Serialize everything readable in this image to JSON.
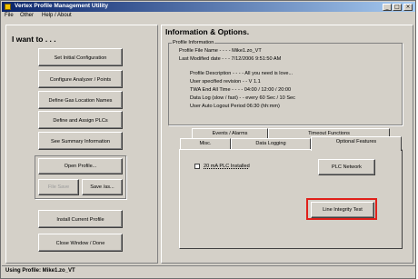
{
  "window": {
    "title": "Vertex Profile Management Utility",
    "controls": {
      "minimize": "_",
      "maximize": "□",
      "close": "×"
    }
  },
  "menu": [
    "File",
    "Other",
    "Help / About"
  ],
  "left": {
    "heading": "I want to . . .",
    "buttons": {
      "setup": "Set Initial Configuration",
      "analyzer": "Configure Analyzer / Points",
      "gas": "Define Gas Location Names",
      "plcs": "Define and Assign PLCs",
      "summary": "See Summary Information",
      "open": "Open Profile...",
      "file_save": "File Save",
      "save_as": "Save /as...",
      "install": "Install Current Profile",
      "close": "Close Window / Done"
    }
  },
  "right": {
    "heading": "Information & Options.",
    "profile_info": {
      "legend": "Profile Information",
      "file_name": "Profile File Name - - - -  Mike1.zo_VT",
      "last_modified": "Last Modified date - - -  7/12/2006 9:51:50 AM",
      "description": "Profile Description - - - - All you need is love...",
      "revision": "User specified revision  - - V 1.1",
      "twa": "TWA End All Time  - - - -  04:00  /  12:00  /  20:00",
      "data_log": "Data  Log (slow / fast) - - every 60 Sec / 10 Sec",
      "logout": "User Auto Logout Period   06:30 (hh:mm)"
    },
    "tabs": {
      "events": "Events / Alarms",
      "timeout": "Timeout Functions",
      "misc": "Misc.",
      "data_logging": "Data Logging",
      "optional": "Optional Features"
    },
    "optional_features": {
      "plc_checkbox": "20 mA PLC Installed",
      "plc_network": "PLC Network",
      "line_integrity": "Line Integrity Test"
    }
  },
  "status": "Using Profile:  Mike1.zo_VT",
  "colors": {
    "title_start": "#0a246a",
    "title_end": "#a6caf0",
    "face": "#d4d0c8",
    "highlight": "#e0201a"
  }
}
